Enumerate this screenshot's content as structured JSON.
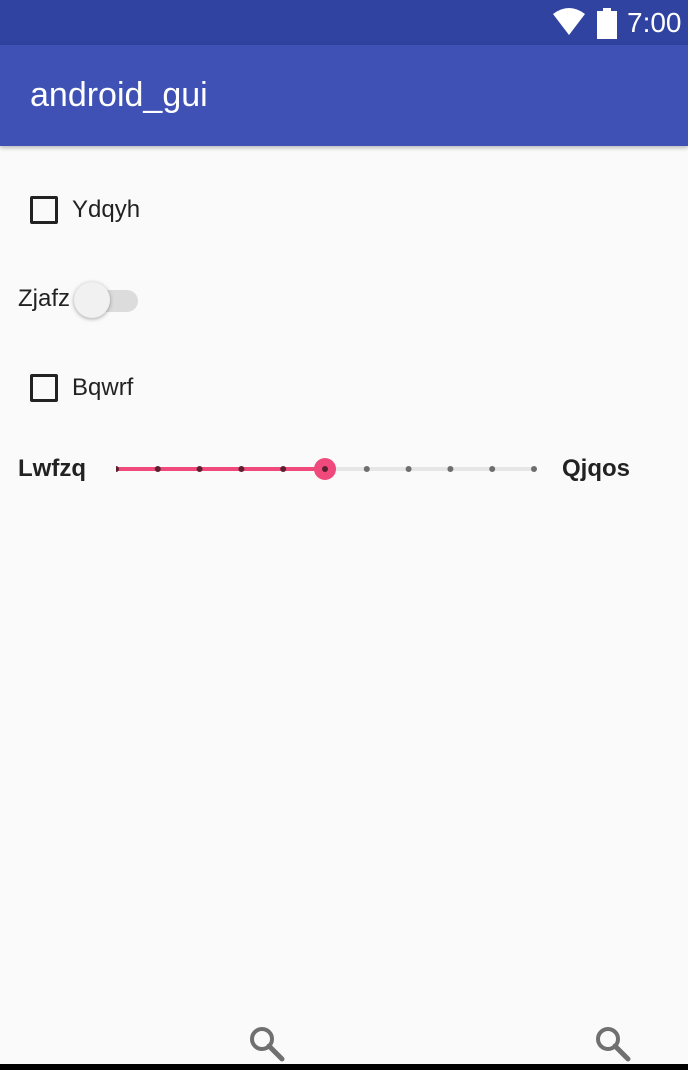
{
  "status_bar": {
    "time": "7:00",
    "icons": [
      "wifi-icon",
      "battery-icon"
    ]
  },
  "app_bar": {
    "title": "android_gui"
  },
  "controls": {
    "checkbox1": {
      "label": "Ydqyh",
      "checked": false
    },
    "switch1": {
      "label": "Zjafz",
      "on": false
    },
    "checkbox2": {
      "label": "Bqwrf",
      "checked": false
    },
    "seekbar": {
      "left_label": "Lwfzq",
      "right_label": "Qjqos",
      "value": 5,
      "max": 10
    }
  },
  "bottom_icons": [
    "search-icon",
    "search-icon"
  ],
  "colors": {
    "status_bar": "#3043a0",
    "app_bar": "#3f51b5",
    "accent": "#ef4a7b",
    "background": "#fafafa"
  }
}
